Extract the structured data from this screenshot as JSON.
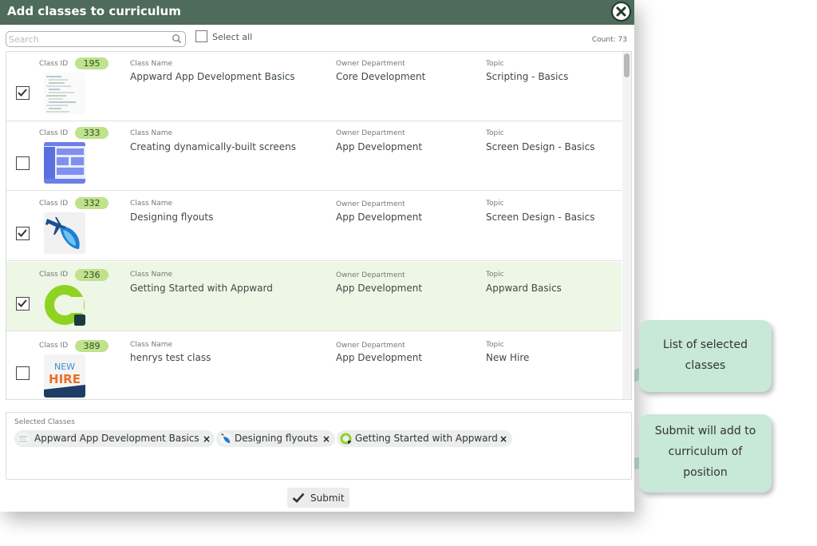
{
  "dialog": {
    "title": "Add classes to curriculum",
    "search_placeholder": "Search",
    "select_all_label": "Select all",
    "count_label": "Count: 73",
    "field_labels": {
      "class_id": "Class ID",
      "class_name": "Class Name",
      "owner_department": "Owner Department",
      "topic": "Topic"
    },
    "rows": [
      {
        "id": "195",
        "name": "Appward App Development Basics",
        "department": "Core Development",
        "topic": "Scripting - Basics",
        "checked": true
      },
      {
        "id": "333",
        "name": "Creating dynamically-built screens",
        "department": "App Development",
        "topic": "Screen Design - Basics",
        "checked": false
      },
      {
        "id": "332",
        "name": "Designing flyouts",
        "department": "App Development",
        "topic": "Screen Design - Basics",
        "checked": true
      },
      {
        "id": "236",
        "name": "Getting Started with Appward",
        "department": "App Development",
        "topic": "Appward Basics",
        "checked": true
      },
      {
        "id": "389",
        "name": "henrys test class",
        "department": "App Development",
        "topic": "New Hire",
        "checked": false
      }
    ],
    "thumb_new_hire": {
      "line1": "NEW",
      "line2": "HIRE"
    },
    "selected_label": "Selected Classes",
    "selected": [
      "Appward App Development Basics",
      "Designing flyouts",
      "Getting Started with Appward"
    ],
    "chip_remove": "×",
    "submit_label": "Submit"
  },
  "callouts": {
    "list": "List of selected classes",
    "submit": "Submit will add to curriculum of position"
  },
  "colors": {
    "titlebar": "#4e6b5b",
    "badge": "#bfe28c",
    "highlight_row": "#eef6e6",
    "callout": "#c8e8d8"
  }
}
